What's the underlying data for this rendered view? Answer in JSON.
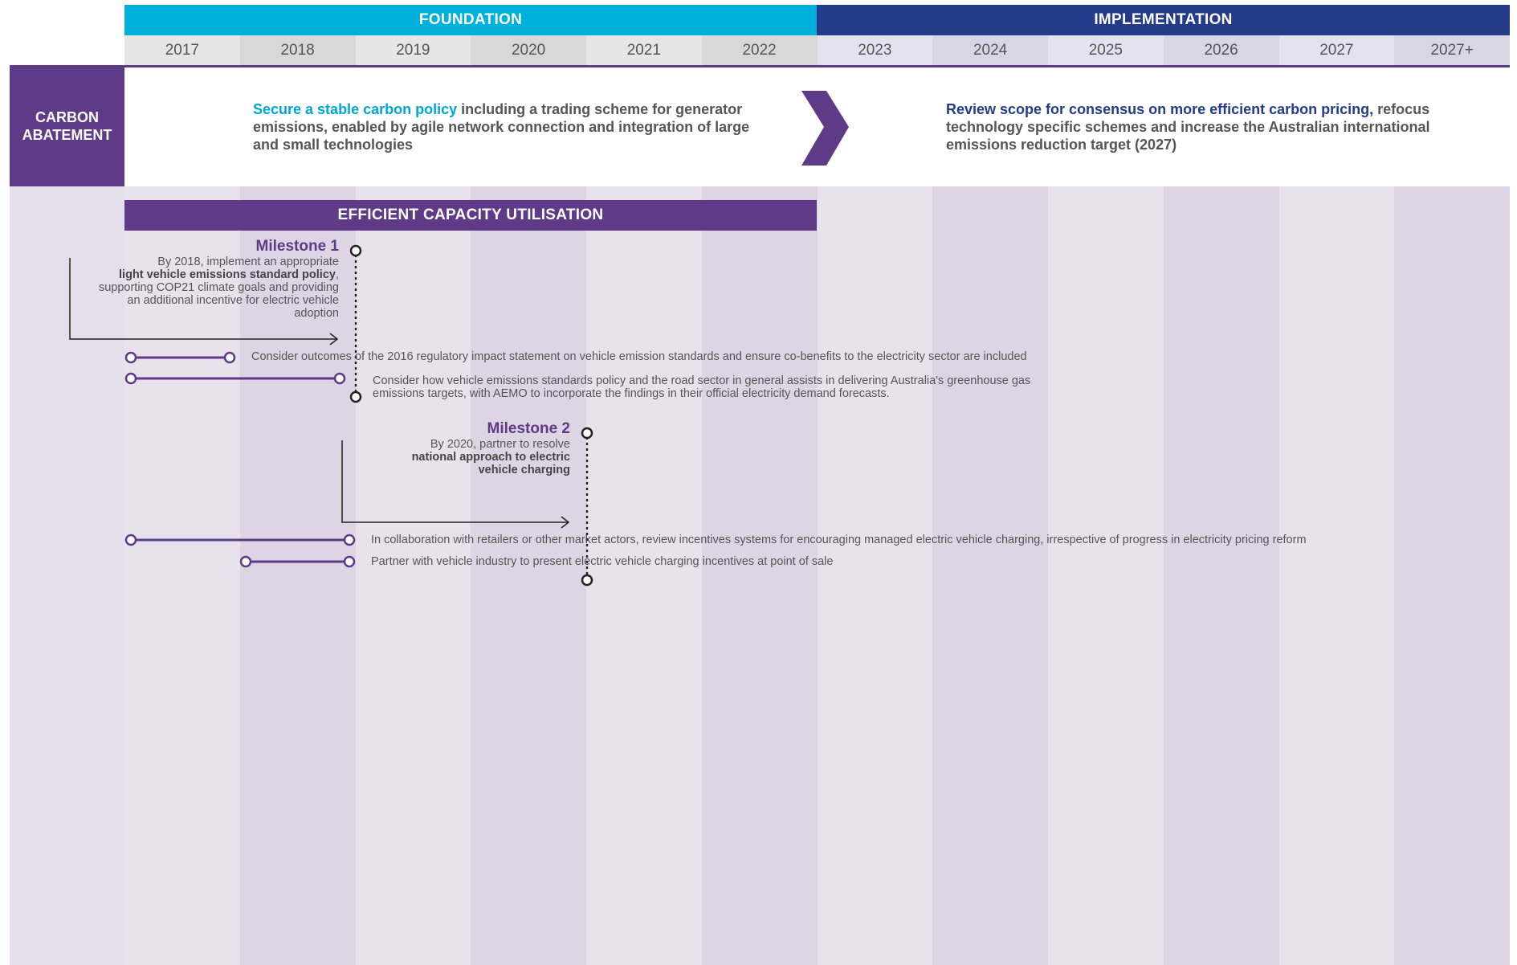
{
  "phases": {
    "foundation": {
      "label": "FOUNDATION",
      "color": "#00b0dc"
    },
    "implementation": {
      "label": "IMPLEMENTATION",
      "color": "#243b89"
    }
  },
  "years": [
    "2017",
    "2018",
    "2019",
    "2020",
    "2021",
    "2022",
    "2023",
    "2024",
    "2025",
    "2026",
    "2027",
    "2027+"
  ],
  "row": {
    "label": "CARBON\nABATEMENT",
    "color": "#5f3a86"
  },
  "foundation_statement": {
    "highlight": "Secure a stable carbon policy",
    "rest": " including a trading scheme for generator emissions, enabled by agile network connection and integration of large and small technologies"
  },
  "implementation_statement": {
    "highlight": "Review scope for consensus on more efficient carbon pricing,",
    "rest": " refocus technology specific schemes and increase the Australian international emissions reduction target (2027)"
  },
  "band": {
    "label": "EFFICIENT CAPACITY UTILISATION"
  },
  "milestone1": {
    "title": "Milestone 1",
    "pre": "By 2018, implement an appropriate",
    "bold": "light vehicle emissions standard policy",
    "post": ", supporting COP21 climate goals and providing an additional incentive for electric vehicle adoption"
  },
  "milestone2": {
    "title": "Milestone 2",
    "pre": "By 2020, partner to resolve",
    "bold": "national approach to electric vehicle charging"
  },
  "actions": [
    "Consider outcomes of the 2016 regulatory impact statement on vehicle emission standards and ensure co-benefits to the electricity sector are included",
    "Consider how vehicle emissions standards policy and the road sector in general assists in delivering Australia's greenhouse gas emissions targets, with AEMO to incorporate the findings in their official electricity demand forecasts.",
    "In collaboration with retailers or other market actors, review incentives systems for encouraging managed electric vehicle charging, irrespective of progress in electricity pricing reform",
    "Partner with vehicle industry to present electric vehicle charging incentives at point of sale"
  ]
}
